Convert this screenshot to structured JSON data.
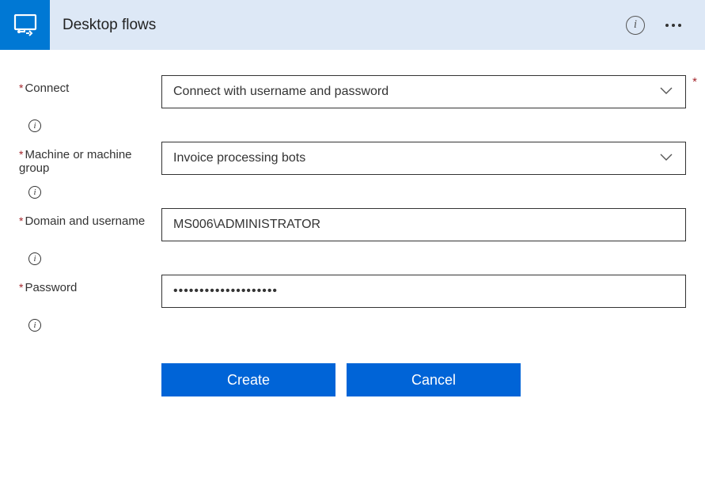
{
  "header": {
    "title": "Desktop flows"
  },
  "form": {
    "connect": {
      "label": "Connect",
      "value": "Connect with username and password",
      "required": true
    },
    "machine": {
      "label": "Machine or machine group",
      "value": "Invoice processing bots",
      "required": true
    },
    "domain": {
      "label": "Domain and username",
      "value": "MS006\\ADMINISTRATOR",
      "required": true
    },
    "password": {
      "label": "Password",
      "value": "••••••••••••••••••••",
      "required": true
    }
  },
  "buttons": {
    "create": "Create",
    "cancel": "Cancel"
  }
}
